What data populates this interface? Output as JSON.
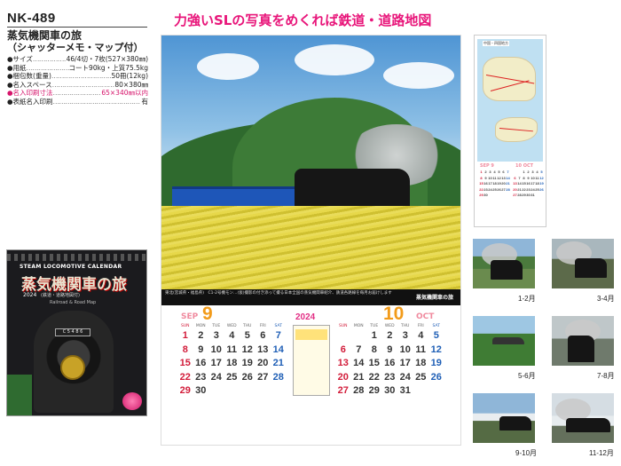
{
  "product": {
    "code": "NK-489",
    "title": "蒸気機関車の旅",
    "subtitle": "（シャッターメモ・マップ付）"
  },
  "specs": [
    {
      "label": "●サイズ",
      "dots": "………………",
      "value": "46/4切・7枚(527×380㎜)",
      "highlight": false
    },
    {
      "label": "●用紙",
      "dots": "…………………………",
      "value": "コート90kg・上質75.5kg",
      "highlight": false
    },
    {
      "label": "●梱包数(重量)",
      "dots": "……………………………",
      "value": "50冊(12kg)",
      "highlight": false
    },
    {
      "label": "●名入スペース",
      "dots": "……………………………",
      "value": "80×380㎜",
      "highlight": false
    },
    {
      "label": "●名入印刷寸法",
      "dots": "……………………",
      "value": "65×340㎜以内",
      "highlight": true
    },
    {
      "label": "●表紙名入印刷",
      "dots": "……………………………………",
      "value": "有",
      "highlight": false
    }
  ],
  "cover": {
    "en_title": "STEAM LOCOMOTIVE CALENDAR",
    "title": "蒸気機関車の旅",
    "year": "2024",
    "sub": "(鉄道・道路地図付)",
    "en_sub": "Railroad & Road Map",
    "plate": "C 5 4 8 6"
  },
  "headline": "力強いSLの写真をめくれば鉄道・道路地図",
  "main_calendar": {
    "caption_title": "蒸気機関車の旅",
    "caption_text": "東北(宮城県・福島県)　C1-2号機モン…(仮)撮影の付き添って撮る日本全国の蒸気機関車紹介、鉄道各路線を毎月お届けします",
    "year": "2024",
    "dow": [
      "SUN",
      "MON",
      "TUE",
      "WED",
      "THU",
      "FRI",
      "SAT"
    ],
    "sep": {
      "en": "SEP",
      "num": "9",
      "weeks": [
        [
          "1",
          "2",
          "3",
          "4",
          "5",
          "6",
          "7"
        ],
        [
          "8",
          "9",
          "10",
          "11",
          "12",
          "13",
          "14"
        ],
        [
          "15",
          "16",
          "17",
          "18",
          "19",
          "20",
          "21"
        ],
        [
          "22",
          "23",
          "24",
          "25",
          "26",
          "27",
          "28"
        ],
        [
          "29",
          "30",
          "",
          "",
          "",
          "",
          ""
        ]
      ]
    },
    "oct": {
      "en": "OCT",
      "num": "10",
      "weeks": [
        [
          "",
          "",
          "1",
          "2",
          "3",
          "4",
          "5"
        ],
        [
          "6",
          "7",
          "8",
          "9",
          "10",
          "11",
          "12"
        ],
        [
          "13",
          "14",
          "15",
          "16",
          "17",
          "18",
          "19"
        ],
        [
          "20",
          "21",
          "22",
          "23",
          "24",
          "25",
          "26"
        ],
        [
          "27",
          "28",
          "29",
          "30",
          "31",
          "",
          ""
        ]
      ]
    }
  },
  "map_page": {
    "map_title": "中国・四国地方",
    "sep_label": "SEP 9",
    "oct_label": "10 OCT",
    "sep_days": [
      "",
      "",
      "",
      "",
      "",
      "",
      "",
      "1",
      "2",
      "3",
      "4",
      "5",
      "6",
      "7",
      "8",
      "9",
      "10",
      "11",
      "12",
      "13",
      "14",
      "15",
      "16",
      "17",
      "18",
      "19",
      "20",
      "21",
      "22",
      "23",
      "24",
      "25",
      "26",
      "27",
      "28",
      "29",
      "30"
    ],
    "oct_days": [
      "",
      "",
      "1",
      "2",
      "3",
      "4",
      "5",
      "6",
      "7",
      "8",
      "9",
      "10",
      "11",
      "12",
      "13",
      "14",
      "15",
      "16",
      "17",
      "18",
      "19",
      "20",
      "21",
      "22",
      "23",
      "24",
      "25",
      "26",
      "27",
      "28",
      "29",
      "30",
      "31"
    ]
  },
  "thumbnails": [
    {
      "label": "1-2月"
    },
    {
      "label": "3-4月"
    },
    {
      "label": "5-6月"
    },
    {
      "label": "7-8月"
    },
    {
      "label": "9-10月"
    },
    {
      "label": "11-12月"
    }
  ],
  "colors": {
    "accent_pink": "#e8157a",
    "month_orange": "#f29b1a",
    "sunday_red": "#d21c3a",
    "saturday_blue": "#1f5fb6"
  }
}
